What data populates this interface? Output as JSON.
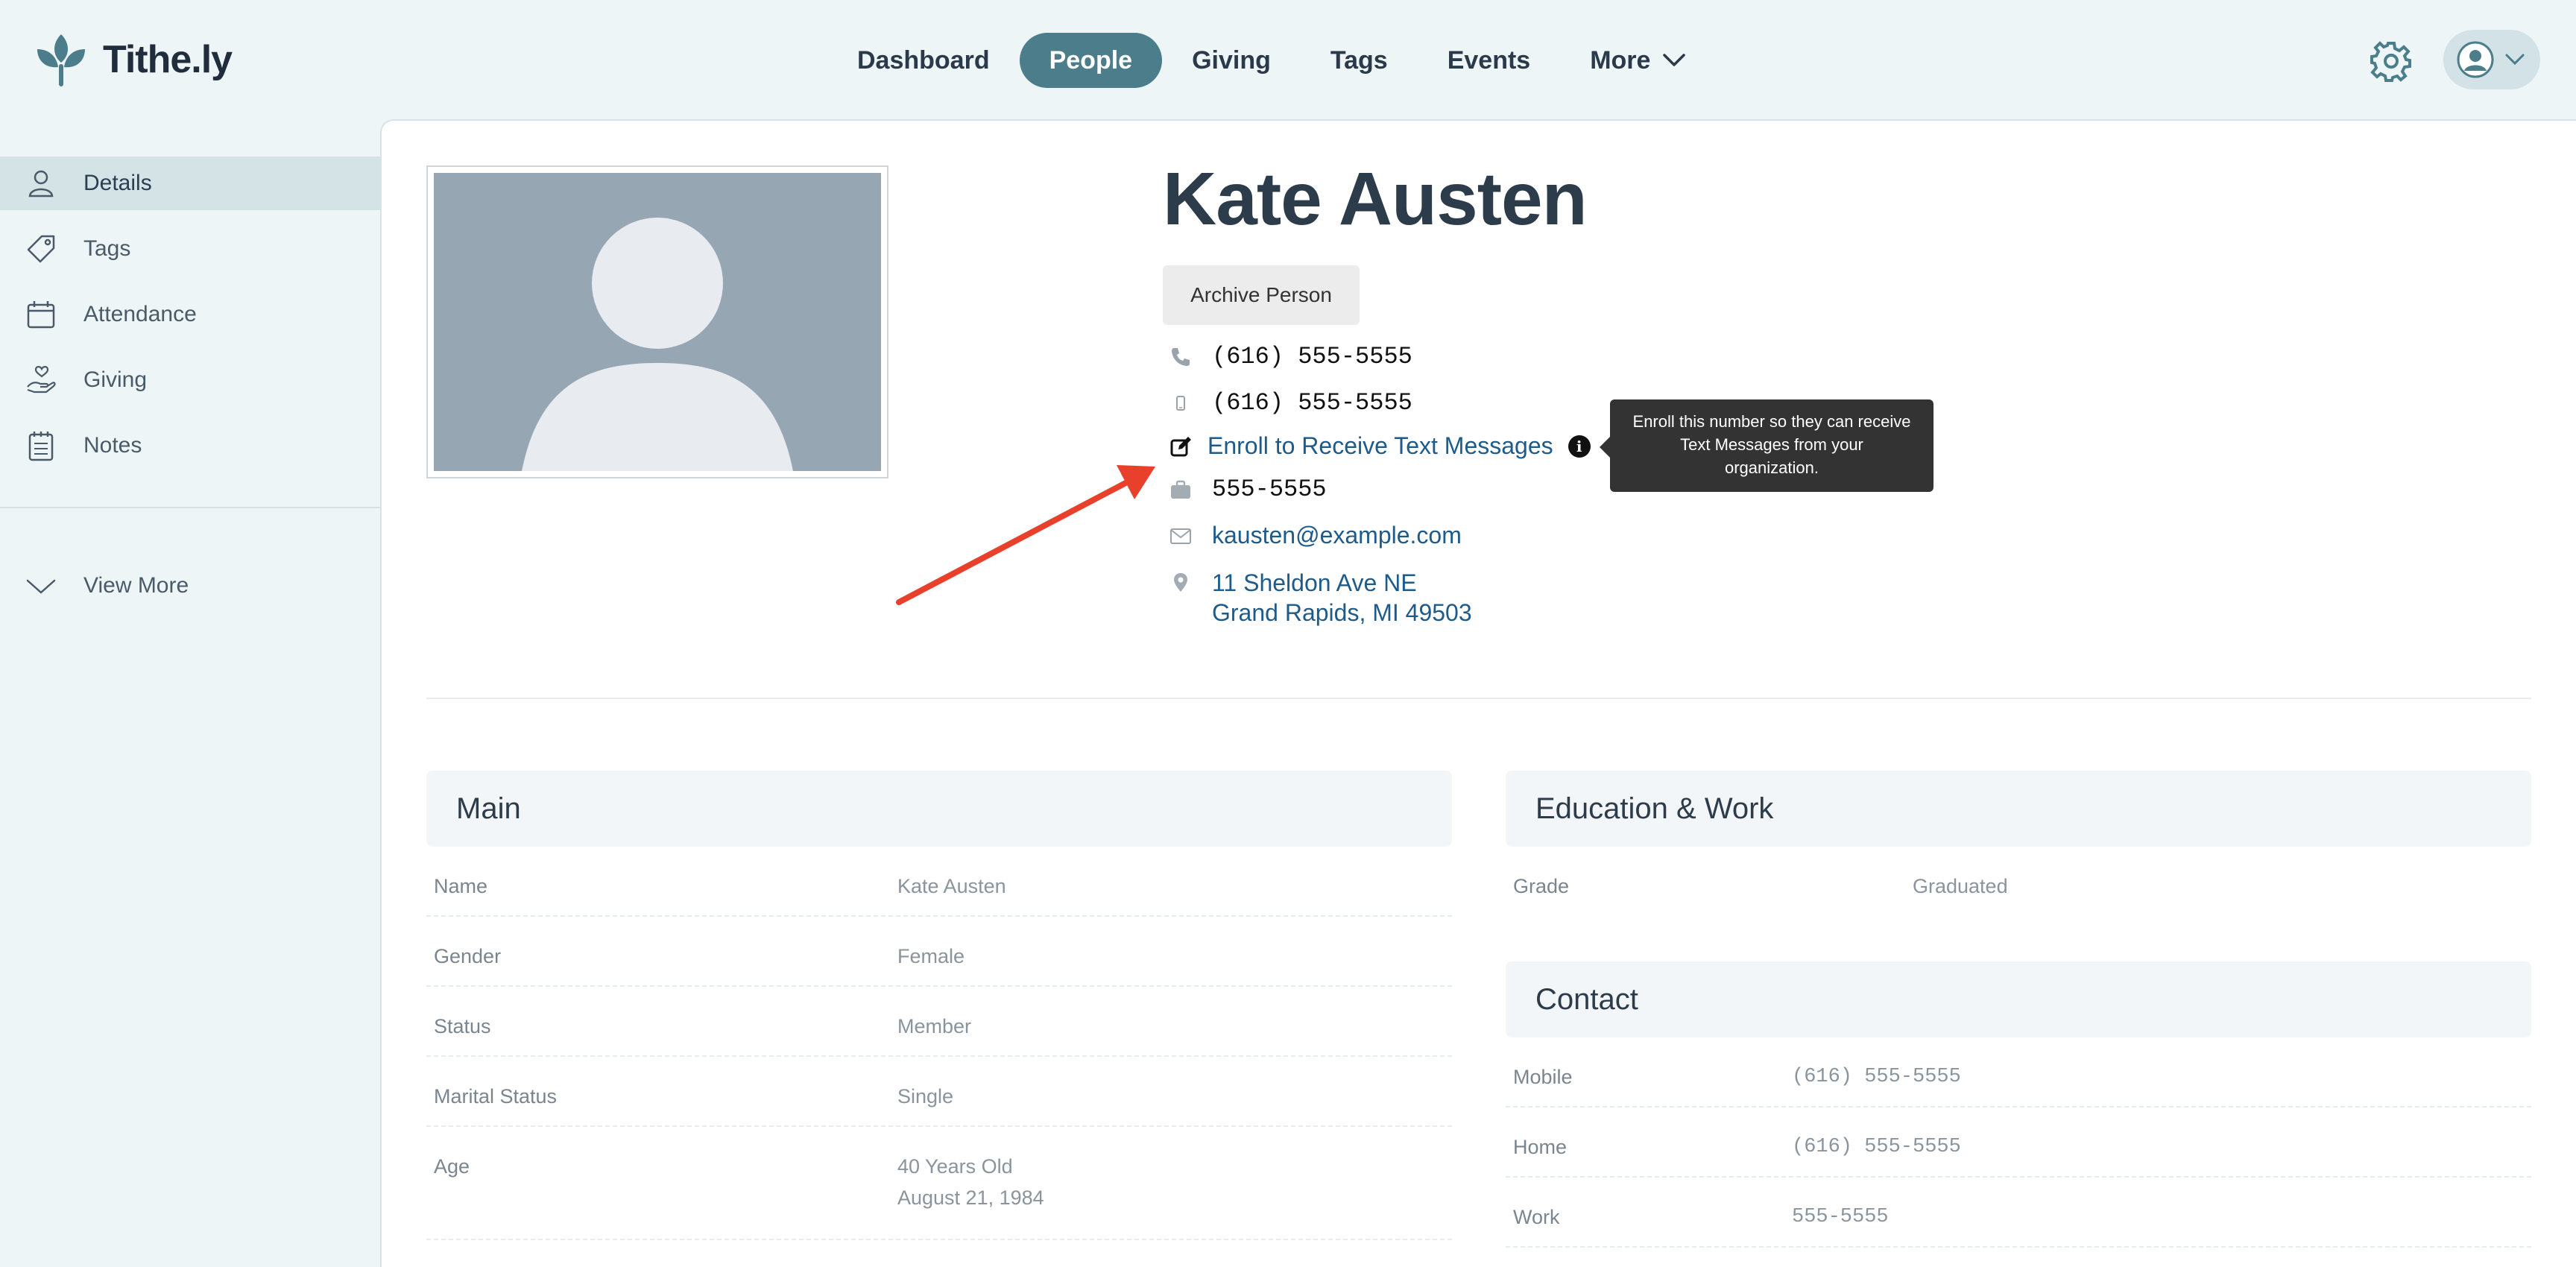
{
  "app": {
    "name": "Tithe.ly"
  },
  "nav": {
    "items": [
      "Dashboard",
      "People",
      "Giving",
      "Tags",
      "Events",
      "More"
    ],
    "active": "People"
  },
  "sidebar": {
    "items": [
      {
        "label": "Details",
        "icon": "person-icon"
      },
      {
        "label": "Tags",
        "icon": "tag-icon"
      },
      {
        "label": "Attendance",
        "icon": "calendar-icon"
      },
      {
        "label": "Giving",
        "icon": "hand-heart-icon"
      },
      {
        "label": "Notes",
        "icon": "notepad-icon"
      }
    ],
    "view_more": "View More"
  },
  "person": {
    "name": "Kate Austen",
    "archive_label": "Archive Person",
    "phone_home": "(616) 555-5555",
    "phone_mobile": "(616) 555-5555",
    "enroll_label": "Enroll to Receive Text Messages",
    "phone_work": "555-5555",
    "email": "kausten@example.com",
    "address_line1": "11 Sheldon Ave NE",
    "address_line2": "Grand Rapids, MI 49503"
  },
  "tooltip": {
    "line1": "Enroll this number so they can receive",
    "line2": "Text Messages from your",
    "line3": "organization."
  },
  "main_panel": {
    "title": "Main",
    "fields": [
      {
        "label": "Name",
        "value": "Kate Austen"
      },
      {
        "label": "Gender",
        "value": "Female"
      },
      {
        "label": "Status",
        "value": "Member"
      },
      {
        "label": "Marital Status",
        "value": "Single"
      },
      {
        "label": "Age",
        "value": "40 Years Old",
        "value2": "August 21, 1984"
      }
    ]
  },
  "education_panel": {
    "title": "Education & Work",
    "fields": [
      {
        "label": "Grade",
        "value": "Graduated"
      }
    ]
  },
  "contact_panel": {
    "title": "Contact",
    "fields": [
      {
        "label": "Mobile",
        "value": "(616) 555-5555"
      },
      {
        "label": "Home",
        "value": "(616) 555-5555"
      },
      {
        "label": "Work",
        "value": "555-5555"
      }
    ]
  },
  "colors": {
    "brand": "#4b7d8b",
    "background": "#eef5f6",
    "link": "#1f5b8a",
    "annotation_arrow": "#e8402b"
  }
}
